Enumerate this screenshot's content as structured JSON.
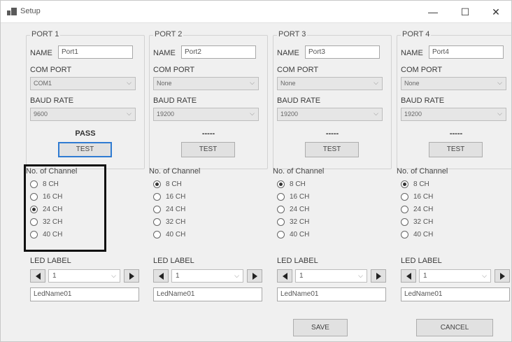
{
  "window": {
    "title": "Setup",
    "minimize": "—",
    "maximize": "☐",
    "close": "✕"
  },
  "labels": {
    "name": "NAME",
    "com_port": "COM PORT",
    "baud_rate": "BAUD RATE",
    "channel": "No. of Channel",
    "led_label": "LED LABEL",
    "test_button": "TEST"
  },
  "ports": [
    {
      "title": "PORT 1",
      "name": "Port1",
      "com_port": "COM1",
      "baud_rate": "9600",
      "status": "PASS",
      "channels": [
        "8 CH",
        "16 CH",
        "24 CH",
        "32 CH",
        "40 CH"
      ],
      "selected_channel": 2,
      "led_index": "1",
      "led_name": "LedName01"
    },
    {
      "title": "PORT 2",
      "name": "Port2",
      "com_port": "None",
      "baud_rate": "19200",
      "status": "-----",
      "channels": [
        "8 CH",
        "16 CH",
        "24 CH",
        "32 CH",
        "40 CH"
      ],
      "selected_channel": 0,
      "led_index": "1",
      "led_name": "LedName01"
    },
    {
      "title": "PORT 3",
      "name": "Port3",
      "com_port": "None",
      "baud_rate": "19200",
      "status": "-----",
      "channels": [
        "8 CH",
        "16 CH",
        "24 CH",
        "32 CH",
        "40 CH"
      ],
      "selected_channel": 0,
      "led_index": "1",
      "led_name": "LedName01"
    },
    {
      "title": "PORT 4",
      "name": "Port4",
      "com_port": "None",
      "baud_rate": "19200",
      "status": "-----",
      "channels": [
        "8 CH",
        "16 CH",
        "24 CH",
        "32 CH",
        "40 CH"
      ],
      "selected_channel": 0,
      "led_index": "1",
      "led_name": "LedName01"
    }
  ],
  "footer": {
    "save": "SAVE",
    "cancel": "CANCEL"
  }
}
